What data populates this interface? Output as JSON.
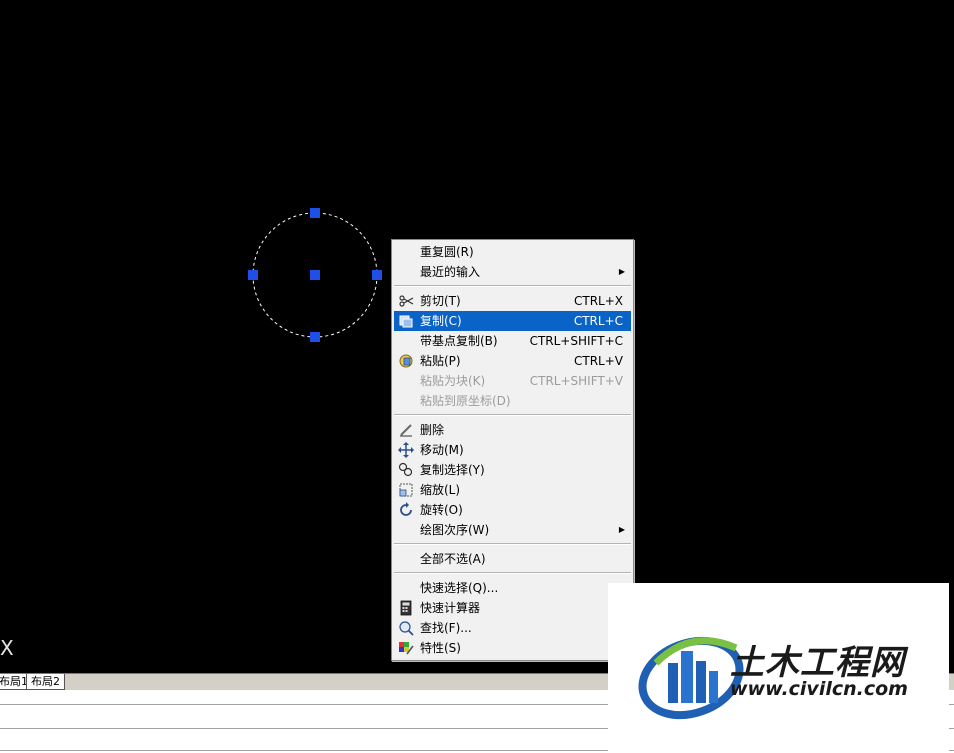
{
  "canvas": {
    "axis_label": "X"
  },
  "tabs": {
    "layout1": "布局1",
    "layout2": "布局2"
  },
  "menu": {
    "repeat": "重复圆(R)",
    "recent_input": "最近的输入",
    "cut": "剪切(T)",
    "cut_sc": "CTRL+X",
    "copy": "复制(C)",
    "copy_sc": "CTRL+C",
    "copy_base": "带基点复制(B)",
    "copy_base_sc": "CTRL+SHIFT+C",
    "paste": "粘贴(P)",
    "paste_sc": "CTRL+V",
    "paste_block": "粘贴为块(K)",
    "paste_block_sc": "CTRL+SHIFT+V",
    "paste_orig": "粘贴到原坐标(D)",
    "erase": "删除",
    "move": "移动(M)",
    "copy_select": "复制选择(Y)",
    "scale": "缩放(L)",
    "rotate": "旋转(O)",
    "draw_order": "绘图次序(W)",
    "deselect_all": "全部不选(A)",
    "quick_select": "快速选择(Q)...",
    "quick_calc": "快速计算器",
    "find": "查找(F)...",
    "properties": "特性(S)"
  },
  "watermark": {
    "title": "土木工程网",
    "url": "www.civilcn.com"
  },
  "colors": {
    "selection": "#0a64c8",
    "grip": "#1e4fe6",
    "menu_bg": "#f1f1f1"
  }
}
